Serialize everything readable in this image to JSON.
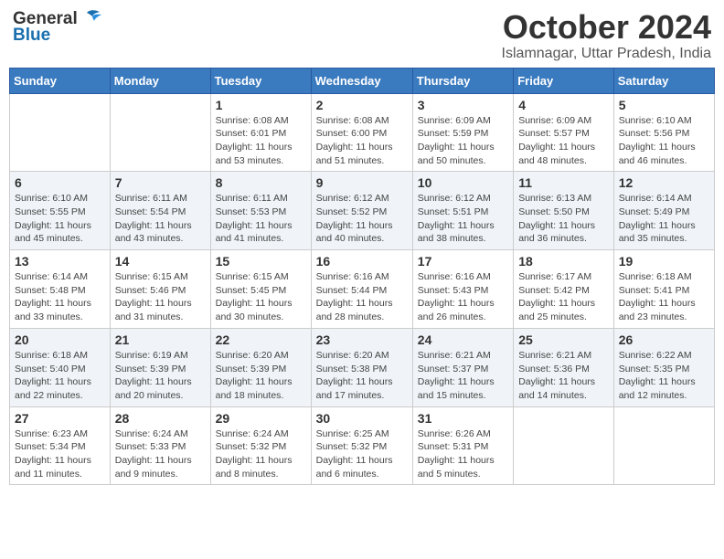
{
  "logo": {
    "general": "General",
    "blue": "Blue"
  },
  "title": "October 2024",
  "location": "Islamnagar, Uttar Pradesh, India",
  "days_of_week": [
    "Sunday",
    "Monday",
    "Tuesday",
    "Wednesday",
    "Thursday",
    "Friday",
    "Saturday"
  ],
  "weeks": [
    [
      {
        "day": "",
        "info": ""
      },
      {
        "day": "",
        "info": ""
      },
      {
        "day": "1",
        "info": "Sunrise: 6:08 AM\nSunset: 6:01 PM\nDaylight: 11 hours and 53 minutes."
      },
      {
        "day": "2",
        "info": "Sunrise: 6:08 AM\nSunset: 6:00 PM\nDaylight: 11 hours and 51 minutes."
      },
      {
        "day": "3",
        "info": "Sunrise: 6:09 AM\nSunset: 5:59 PM\nDaylight: 11 hours and 50 minutes."
      },
      {
        "day": "4",
        "info": "Sunrise: 6:09 AM\nSunset: 5:57 PM\nDaylight: 11 hours and 48 minutes."
      },
      {
        "day": "5",
        "info": "Sunrise: 6:10 AM\nSunset: 5:56 PM\nDaylight: 11 hours and 46 minutes."
      }
    ],
    [
      {
        "day": "6",
        "info": "Sunrise: 6:10 AM\nSunset: 5:55 PM\nDaylight: 11 hours and 45 minutes."
      },
      {
        "day": "7",
        "info": "Sunrise: 6:11 AM\nSunset: 5:54 PM\nDaylight: 11 hours and 43 minutes."
      },
      {
        "day": "8",
        "info": "Sunrise: 6:11 AM\nSunset: 5:53 PM\nDaylight: 11 hours and 41 minutes."
      },
      {
        "day": "9",
        "info": "Sunrise: 6:12 AM\nSunset: 5:52 PM\nDaylight: 11 hours and 40 minutes."
      },
      {
        "day": "10",
        "info": "Sunrise: 6:12 AM\nSunset: 5:51 PM\nDaylight: 11 hours and 38 minutes."
      },
      {
        "day": "11",
        "info": "Sunrise: 6:13 AM\nSunset: 5:50 PM\nDaylight: 11 hours and 36 minutes."
      },
      {
        "day": "12",
        "info": "Sunrise: 6:14 AM\nSunset: 5:49 PM\nDaylight: 11 hours and 35 minutes."
      }
    ],
    [
      {
        "day": "13",
        "info": "Sunrise: 6:14 AM\nSunset: 5:48 PM\nDaylight: 11 hours and 33 minutes."
      },
      {
        "day": "14",
        "info": "Sunrise: 6:15 AM\nSunset: 5:46 PM\nDaylight: 11 hours and 31 minutes."
      },
      {
        "day": "15",
        "info": "Sunrise: 6:15 AM\nSunset: 5:45 PM\nDaylight: 11 hours and 30 minutes."
      },
      {
        "day": "16",
        "info": "Sunrise: 6:16 AM\nSunset: 5:44 PM\nDaylight: 11 hours and 28 minutes."
      },
      {
        "day": "17",
        "info": "Sunrise: 6:16 AM\nSunset: 5:43 PM\nDaylight: 11 hours and 26 minutes."
      },
      {
        "day": "18",
        "info": "Sunrise: 6:17 AM\nSunset: 5:42 PM\nDaylight: 11 hours and 25 minutes."
      },
      {
        "day": "19",
        "info": "Sunrise: 6:18 AM\nSunset: 5:41 PM\nDaylight: 11 hours and 23 minutes."
      }
    ],
    [
      {
        "day": "20",
        "info": "Sunrise: 6:18 AM\nSunset: 5:40 PM\nDaylight: 11 hours and 22 minutes."
      },
      {
        "day": "21",
        "info": "Sunrise: 6:19 AM\nSunset: 5:39 PM\nDaylight: 11 hours and 20 minutes."
      },
      {
        "day": "22",
        "info": "Sunrise: 6:20 AM\nSunset: 5:39 PM\nDaylight: 11 hours and 18 minutes."
      },
      {
        "day": "23",
        "info": "Sunrise: 6:20 AM\nSunset: 5:38 PM\nDaylight: 11 hours and 17 minutes."
      },
      {
        "day": "24",
        "info": "Sunrise: 6:21 AM\nSunset: 5:37 PM\nDaylight: 11 hours and 15 minutes."
      },
      {
        "day": "25",
        "info": "Sunrise: 6:21 AM\nSunset: 5:36 PM\nDaylight: 11 hours and 14 minutes."
      },
      {
        "day": "26",
        "info": "Sunrise: 6:22 AM\nSunset: 5:35 PM\nDaylight: 11 hours and 12 minutes."
      }
    ],
    [
      {
        "day": "27",
        "info": "Sunrise: 6:23 AM\nSunset: 5:34 PM\nDaylight: 11 hours and 11 minutes."
      },
      {
        "day": "28",
        "info": "Sunrise: 6:24 AM\nSunset: 5:33 PM\nDaylight: 11 hours and 9 minutes."
      },
      {
        "day": "29",
        "info": "Sunrise: 6:24 AM\nSunset: 5:32 PM\nDaylight: 11 hours and 8 minutes."
      },
      {
        "day": "30",
        "info": "Sunrise: 6:25 AM\nSunset: 5:32 PM\nDaylight: 11 hours and 6 minutes."
      },
      {
        "day": "31",
        "info": "Sunrise: 6:26 AM\nSunset: 5:31 PM\nDaylight: 11 hours and 5 minutes."
      },
      {
        "day": "",
        "info": ""
      },
      {
        "day": "",
        "info": ""
      }
    ]
  ]
}
